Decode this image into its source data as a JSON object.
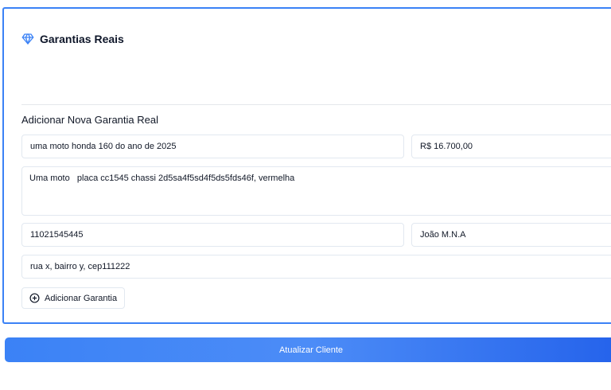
{
  "card": {
    "title": "Garantias Reais",
    "icon": "gem-icon"
  },
  "form": {
    "section_title": "Adicionar Nova Garantia Real",
    "description_short": "uma moto honda 160 do ano de 2025",
    "value": "R$ 16.700,00",
    "details": "Uma moto   placa cc1545 chassi 2d5sa4f5sd4f5ds5fds46f, vermelha",
    "registry_number": "11021545445",
    "owner": "João M.N.A",
    "address": "rua x, bairro y, cep111222",
    "add_button_label": "Adicionar Garantia"
  },
  "footer": {
    "update_button_label": "Atualizar Cliente"
  },
  "colors": {
    "accent": "#3b82f6",
    "button_gradient_end": "#2563eb"
  }
}
